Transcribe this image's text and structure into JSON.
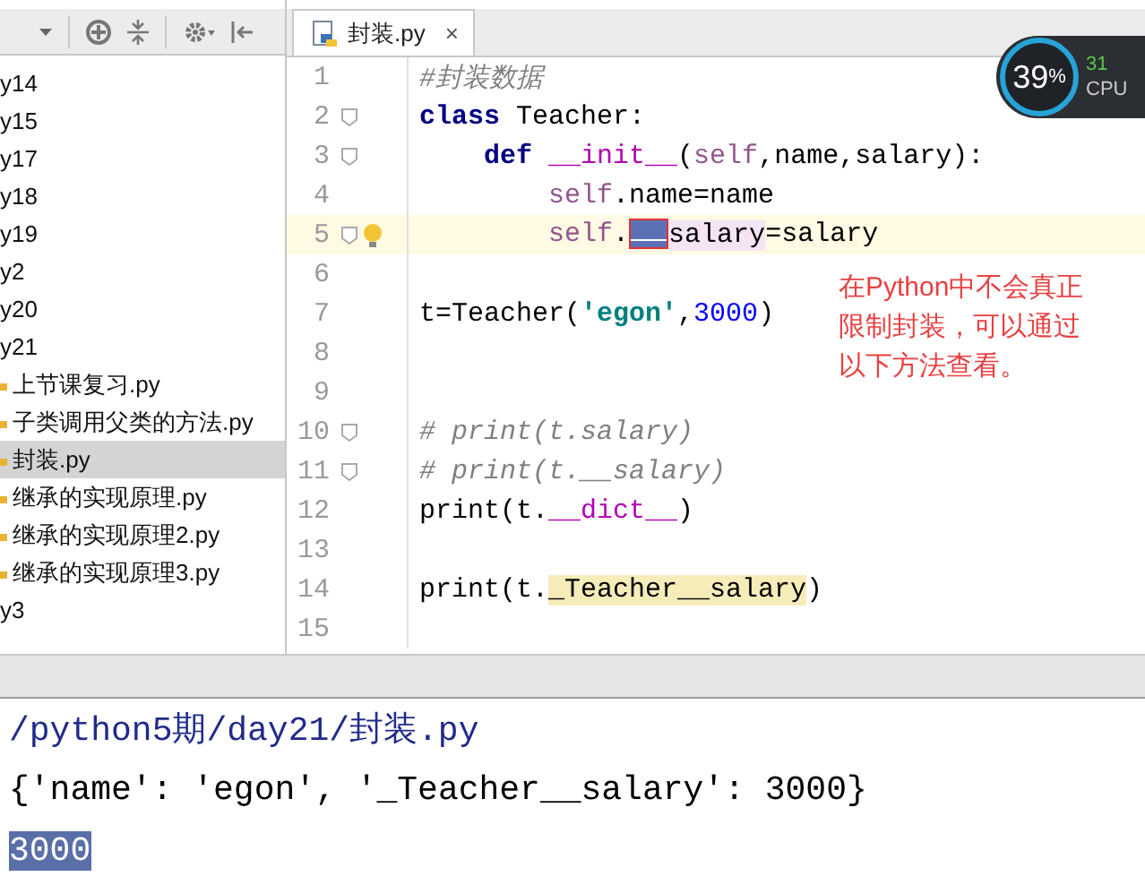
{
  "sidebar": {
    "items": [
      {
        "label": "y14",
        "kind": "folder",
        "selected": false
      },
      {
        "label": "y15",
        "kind": "folder",
        "selected": false
      },
      {
        "label": "y17",
        "kind": "folder",
        "selected": false
      },
      {
        "label": "y18",
        "kind": "folder",
        "selected": false
      },
      {
        "label": "y19",
        "kind": "folder",
        "selected": false
      },
      {
        "label": "y2",
        "kind": "folder",
        "selected": false
      },
      {
        "label": "y20",
        "kind": "folder",
        "selected": false
      },
      {
        "label": "y21",
        "kind": "folder",
        "selected": false
      },
      {
        "label": "上节课复习.py",
        "kind": "file",
        "selected": false
      },
      {
        "label": "子类调用父类的方法.py",
        "kind": "file",
        "selected": false
      },
      {
        "label": "封装.py",
        "kind": "file",
        "selected": true
      },
      {
        "label": "继承的实现原理.py",
        "kind": "file",
        "selected": false
      },
      {
        "label": "继承的实现原理2.py",
        "kind": "file",
        "selected": false
      },
      {
        "label": "继承的实现原理3.py",
        "kind": "file",
        "selected": false
      },
      {
        "label": "y3",
        "kind": "folder",
        "selected": false
      }
    ]
  },
  "editor": {
    "tab": {
      "label": "封装.py",
      "close": "×"
    },
    "lines": [
      {
        "number": "1",
        "segments": [
          {
            "text": "#封装数据",
            "kind": "comment"
          }
        ]
      },
      {
        "number": "2",
        "fold": true,
        "segments": [
          {
            "text": "class",
            "kind": "keyword"
          },
          {
            "text": " Teacher:",
            "kind": "plain"
          }
        ]
      },
      {
        "number": "3",
        "fold": true,
        "segments": [
          {
            "text": "    def",
            "kind": "keyword"
          },
          {
            "text": " __init__",
            "kind": "magic"
          },
          {
            "text": "("
          },
          {
            "text": "self",
            "kind": "self"
          },
          {
            "text": ",name,salary):"
          }
        ]
      },
      {
        "number": "4",
        "segments": [
          {
            "text": "        self",
            "kind": "self"
          },
          {
            "text": ".name=name"
          }
        ]
      },
      {
        "number": "5",
        "fold": true,
        "current": true,
        "bulb": true,
        "segments": [
          {
            "text": "        self",
            "kind": "self"
          },
          {
            "text": "."
          },
          {
            "kind": "selection"
          },
          {
            "text": "salary",
            "kind": "usage"
          },
          {
            "text": "=salary"
          }
        ]
      },
      {
        "number": "6"
      },
      {
        "number": "7",
        "segments": [
          {
            "text": "t=Teacher("
          },
          {
            "text": "'egon'",
            "kind": "string"
          },
          {
            "text": ","
          },
          {
            "text": "3000",
            "kind": "number"
          },
          {
            "text": ")"
          }
        ]
      },
      {
        "number": "8"
      },
      {
        "number": "9"
      },
      {
        "number": "10",
        "fold": true,
        "segments": [
          {
            "text": "# print(t.salary)",
            "kind": "comment"
          }
        ]
      },
      {
        "number": "11",
        "fold": true,
        "segments": [
          {
            "text": "# print(t.__salary)",
            "kind": "comment"
          }
        ]
      },
      {
        "number": "12",
        "segments": [
          {
            "text": "print(t."
          },
          {
            "text": "__dict__",
            "kind": "magic"
          },
          {
            "text": ")"
          }
        ]
      },
      {
        "number": "13"
      },
      {
        "number": "14",
        "segments": [
          {
            "text": "print(t."
          },
          {
            "text": "_Teacher__salary",
            "kind": "highlight"
          },
          {
            "text": ")"
          }
        ]
      },
      {
        "number": "15"
      }
    ],
    "annotation": "在Python中不会真正限制封装，可以通过以下方法查看。"
  },
  "cpu_meter": {
    "percent": "39",
    "unit": "%",
    "secondary": "31",
    "label": "CPU"
  },
  "console": {
    "lines": [
      {
        "text": "/python5期/day21/封装.py",
        "kind": "path",
        "selected": false
      },
      {
        "text": "{'name': 'egon', '_Teacher__salary': 3000}",
        "kind": "output",
        "selected": false
      },
      {
        "text": "3000",
        "kind": "output",
        "selected": true
      }
    ]
  }
}
